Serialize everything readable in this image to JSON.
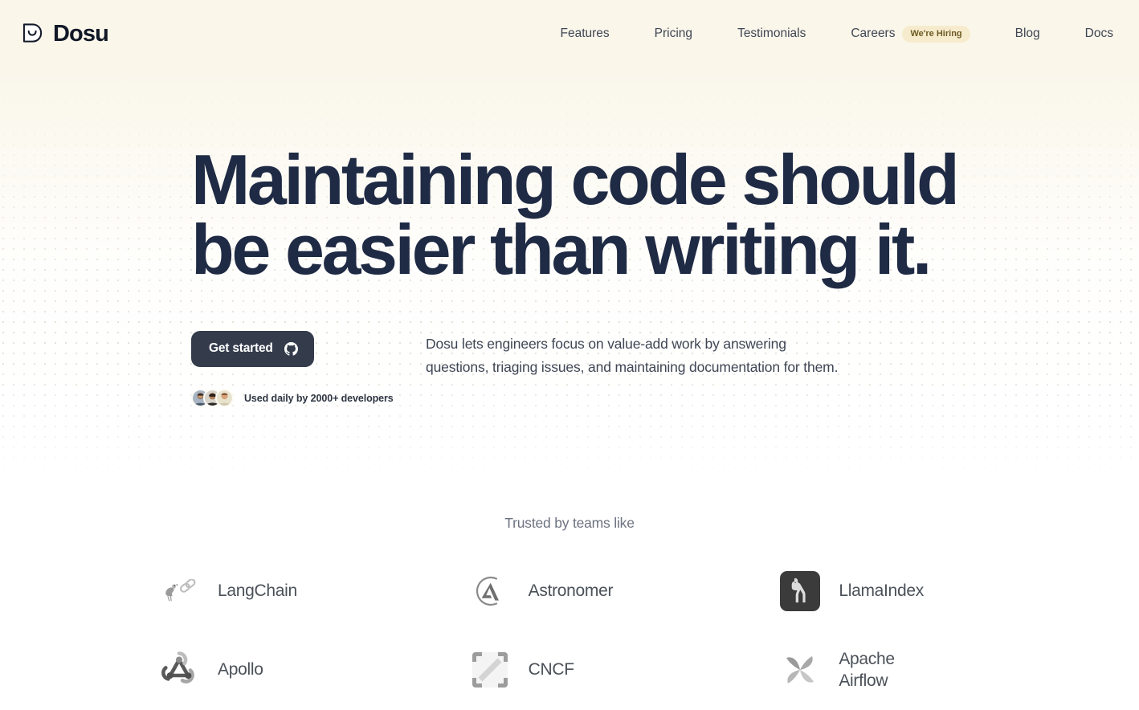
{
  "brand": {
    "name": "Dosu",
    "logo_icon": "dosu-smile-logo"
  },
  "nav": {
    "items": [
      {
        "label": "Features"
      },
      {
        "label": "Pricing"
      },
      {
        "label": "Testimonials"
      },
      {
        "label": "Careers",
        "badge": "We're Hiring"
      },
      {
        "label": "Blog"
      },
      {
        "label": "Docs"
      }
    ]
  },
  "hero": {
    "headline_line1": "Maintaining code should",
    "headline_line2": "be easier than writing it.",
    "cta_label": "Get started",
    "cta_icon": "github-icon",
    "social_proof": "Used daily by 2000+ developers",
    "description": "Dosu lets engineers focus on value-add work by answering questions, triaging issues, and maintaining documentation for them."
  },
  "trusted": {
    "title": "Trusted by teams like",
    "logos": [
      {
        "name": "LangChain",
        "icon": "langchain-parrot-link-icon"
      },
      {
        "name": "Astronomer",
        "icon": "astronomer-a-circle-icon"
      },
      {
        "name": "LlamaIndex",
        "icon": "llamaindex-llama-icon"
      },
      {
        "name": "Apollo",
        "icon": "apollo-nodes-icon"
      },
      {
        "name": "CNCF",
        "icon": "cncf-bracket-icon"
      },
      {
        "name": "Apache\nAirflow",
        "icon": "airflow-pinwheel-icon"
      }
    ]
  },
  "colors": {
    "header_bg": "#faf6ea",
    "headline": "#1f2a44",
    "cta_bg": "#343c4c",
    "badge_bg": "#f6eccd",
    "badge_text": "#6e5a25",
    "body_text": "#3f4654",
    "muted_text": "#6b7280",
    "dot_pattern": "#a8966e"
  }
}
